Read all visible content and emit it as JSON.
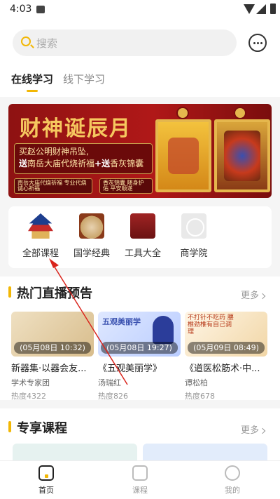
{
  "status_bar": {
    "time": "4:03"
  },
  "search": {
    "placeholder": "搜索"
  },
  "tabs": [
    {
      "label": "在线学习",
      "active": true
    },
    {
      "label": "线下学习",
      "active": false
    }
  ],
  "banner": {
    "title": "财神诞辰月",
    "line1": "买赵公明财神吊坠,",
    "line2_a": "送",
    "line2_b": "南岳大庙代烧祈福",
    "line2_c": "+送",
    "line2_d": "香灰锦囊",
    "sub1": "南岳大庙代烧祈福 专业代烧 诚心祈福",
    "sub2": "香灰锦囊 随身护佑 平安顺遂"
  },
  "categories": [
    {
      "label": "全部课程",
      "icon": "temple-icon"
    },
    {
      "label": "国学经典",
      "icon": "ox-icon"
    },
    {
      "label": "工具大全",
      "icon": "toolbox-icon"
    },
    {
      "label": "商学院",
      "icon": "business-school-icon"
    }
  ],
  "live_section": {
    "title": "热门直播预告",
    "more": "更多",
    "cards": [
      {
        "date": "(05月08日 10:32)",
        "title": "新器集·以器会友...",
        "author": "学术专家团",
        "heat": "热度4322"
      },
      {
        "date": "(05月08日 19:27)",
        "title": "《五观美丽学》",
        "author": "汤瑞红",
        "heat": "热度826",
        "thumb_text": "五观美丽学"
      },
      {
        "date": "(05月09日 08:49)",
        "title": "《道医松筋术·中...",
        "author": "谭松柏",
        "heat": "热度678",
        "thumb_text": "不打针不吃药 腰椎劲椎有自己调理"
      }
    ]
  },
  "exclusive_section": {
    "title": "专享课程",
    "more": "更多"
  },
  "tabbar": [
    {
      "label": "首页",
      "active": true
    },
    {
      "label": "课程",
      "active": false
    },
    {
      "label": "我的",
      "active": false
    }
  ]
}
